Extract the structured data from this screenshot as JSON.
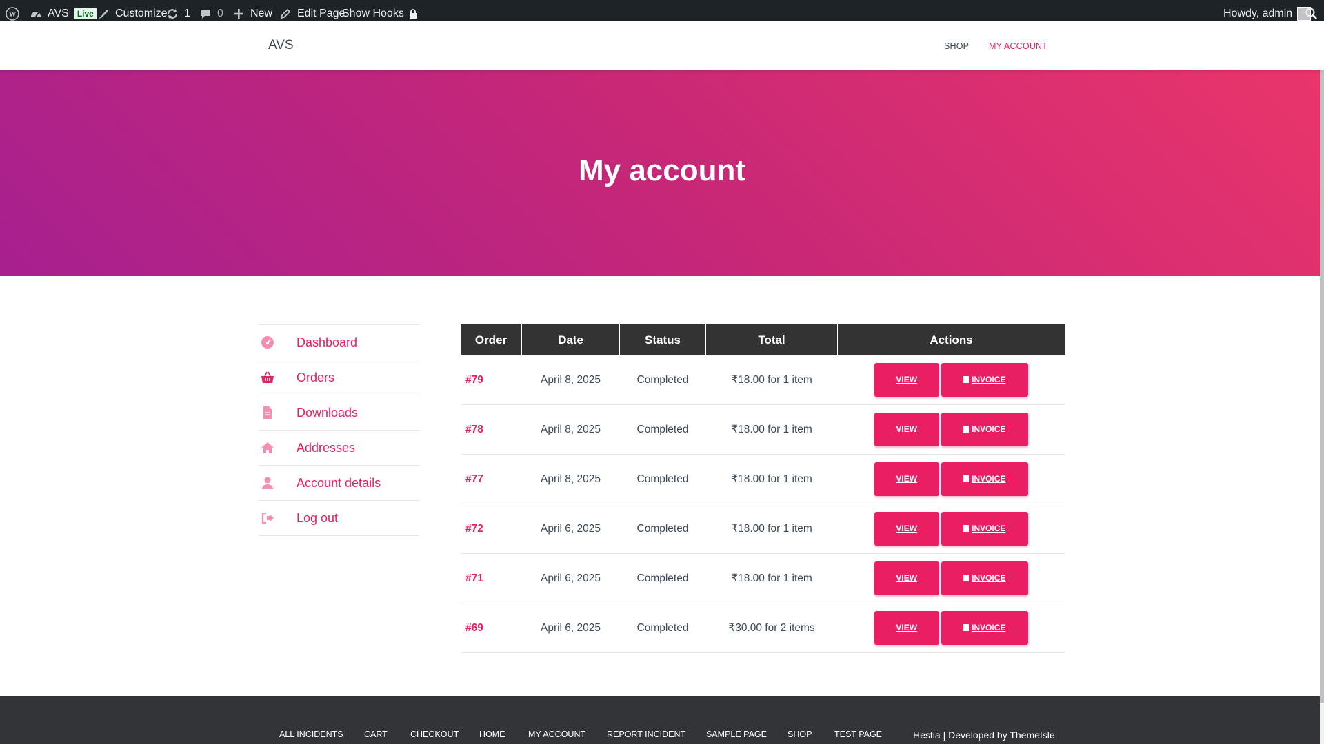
{
  "adminbar": {
    "site_name": "AVS",
    "live_badge": "Live",
    "customize": "Customize",
    "updates_count": "1",
    "comments_count": "0",
    "new_label": "New",
    "edit_page": "Edit Page",
    "show_hooks": "Show Hooks",
    "howdy": "Howdy, admin"
  },
  "header": {
    "brand": "AVS",
    "nav": [
      "SHOP",
      "MY ACCOUNT"
    ]
  },
  "hero": {
    "title": "My account"
  },
  "account_nav": [
    {
      "label": "Dashboard",
      "icon": "dashboard-icon"
    },
    {
      "label": "Orders",
      "icon": "basket-icon"
    },
    {
      "label": "Downloads",
      "icon": "file-icon"
    },
    {
      "label": "Addresses",
      "icon": "home-icon"
    },
    {
      "label": "Account details",
      "icon": "user-icon"
    },
    {
      "label": "Log out",
      "icon": "logout-icon"
    }
  ],
  "orders": {
    "headers": [
      "Order",
      "Date",
      "Status",
      "Total",
      "Actions"
    ],
    "view_label": "VIEW",
    "invoice_label": "INVOICE",
    "rows": [
      {
        "order": "#79",
        "date": "April 8, 2025",
        "status": "Completed",
        "total": "₹18.00 for 1 item"
      },
      {
        "order": "#78",
        "date": "April 8, 2025",
        "status": "Completed",
        "total": "₹18.00 for 1 item"
      },
      {
        "order": "#77",
        "date": "April 8, 2025",
        "status": "Completed",
        "total": "₹18.00 for 1 item"
      },
      {
        "order": "#72",
        "date": "April 6, 2025",
        "status": "Completed",
        "total": "₹18.00 for 1 item"
      },
      {
        "order": "#71",
        "date": "April 6, 2025",
        "status": "Completed",
        "total": "₹18.00 for 1 item"
      },
      {
        "order": "#69",
        "date": "April 6, 2025",
        "status": "Completed",
        "total": "₹30.00 for 2 items"
      }
    ]
  },
  "footer": {
    "menu": [
      "ALL INCIDENTS",
      "CART",
      "CHECKOUT",
      "HOME",
      "MY ACCOUNT",
      "REPORT INCIDENT",
      "SAMPLE PAGE",
      "SHOP",
      "TEST PAGE"
    ],
    "credit": "Hestia | Developed by ThemeIsle"
  },
  "colors": {
    "accent": "#e91e63",
    "adminbar": "#1d2327",
    "table_header": "#333333",
    "footer": "#323437",
    "hero_start": "#a7208f",
    "hero_end": "#ea356b"
  }
}
